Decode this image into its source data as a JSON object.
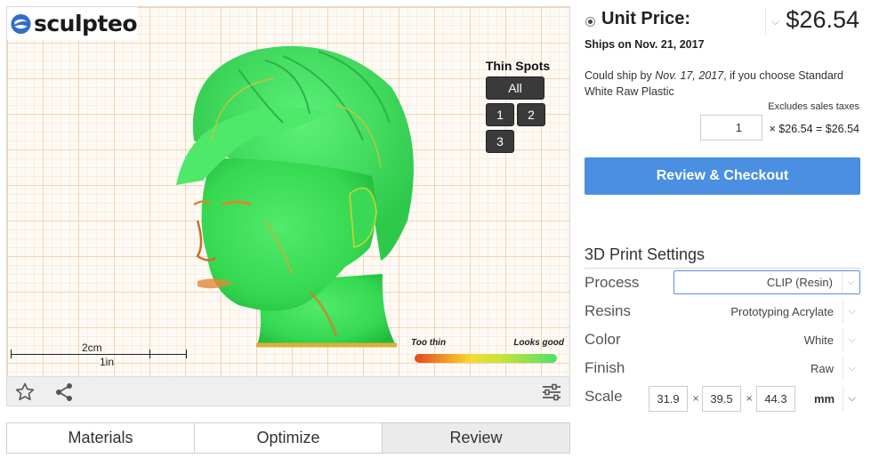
{
  "brand": {
    "name": "sculpteo"
  },
  "viewer": {
    "thin_spots": {
      "title": "Thin Spots",
      "buttons": [
        "All",
        "1",
        "2",
        "3"
      ]
    },
    "scale": {
      "metric": "2cm",
      "imperial": "1in"
    },
    "legend": {
      "left": "Too thin",
      "right": "Looks good"
    },
    "toolbar": {
      "favorite_icon": "star-icon",
      "share_icon": "share-icon",
      "settings_icon": "sliders-icon"
    }
  },
  "tabs": [
    {
      "label": "Materials"
    },
    {
      "label": "Optimize"
    },
    {
      "label": "Review"
    }
  ],
  "pricing": {
    "unit_price_label": "Unit Price:",
    "unit_price": "$26.54",
    "ships_on": "Ships on Nov. 21, 2017",
    "could_ship_prefix": "Could ship by",
    "could_ship_date": "Nov. 17, 2017",
    "could_ship_suffix": ", if you choose Standard White Raw Plastic",
    "excludes_tax": "Excludes sales taxes",
    "quantity": "1",
    "quantity_calc": "× $26.54 = $26.54",
    "checkout_label": "Review & Checkout"
  },
  "settings": {
    "title": "3D Print Settings",
    "process": {
      "label": "Process",
      "value": "CLIP (Resin)"
    },
    "resins": {
      "label": "Resins",
      "value": "Prototyping Acrylate"
    },
    "color": {
      "label": "Color",
      "value": "White"
    },
    "finish": {
      "label": "Finish",
      "value": "Raw"
    },
    "scale": {
      "label": "Scale",
      "x": "31.9",
      "y": "39.5",
      "z": "44.3",
      "unit": "mm",
      "separator": "×"
    }
  },
  "colors": {
    "accent": "#4a8fe2",
    "model_green": "#3ee05a"
  }
}
